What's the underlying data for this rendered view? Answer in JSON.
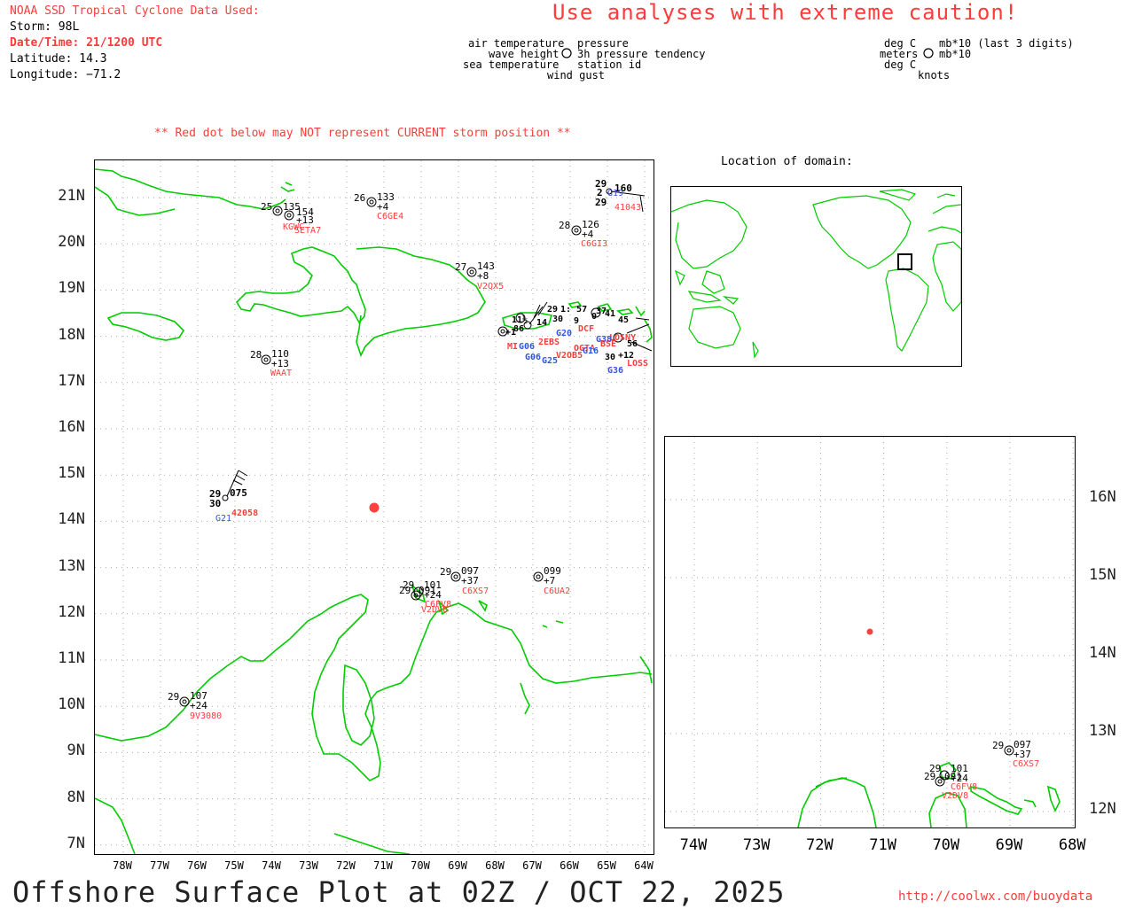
{
  "header": {
    "data_title": "NOAA SSD Tropical Cyclone Data Used:",
    "storm": "Storm: 98L",
    "datetime": "Date/Time: 21/1200 UTC",
    "latitude": "Latitude: 14.3",
    "longitude": "Longitude: −71.2",
    "caution": "Use analyses with extreme caution!",
    "note": "** Red dot below may NOT represent CURRENT storm position **"
  },
  "legend_left": {
    "air_temperature": "air temperature",
    "pressure": "pressure",
    "wave_height": "wave height",
    "pressure_tendency": "3h pressure tendency",
    "sea_temperature": "sea temperature",
    "station_id": "station id",
    "wind_gust": "wind gust"
  },
  "legend_right": {
    "deg_c_1": "deg C",
    "mb_last3": "mb*10 (last 3 digits)",
    "meters": "meters",
    "mb10": "mb*10",
    "deg_c_2": "deg C",
    "knots": "knots"
  },
  "location_title": "Location of domain:",
  "main_map": {
    "lat_labels": [
      "21N",
      "20N",
      "19N",
      "18N",
      "17N",
      "16N",
      "15N",
      "14N",
      "13N",
      "12N",
      "11N",
      "10N",
      "9N",
      "8N",
      "7N"
    ],
    "lon_labels": [
      "78W",
      "77W",
      "76W",
      "75W",
      "74W",
      "73W",
      "72W",
      "71W",
      "70W",
      "69W",
      "68W",
      "67W",
      "66W",
      "65W",
      "64W"
    ]
  },
  "zoom_map": {
    "lat_labels": [
      "16N",
      "15N",
      "14N",
      "13N",
      "12N"
    ],
    "lon_labels": [
      "74W",
      "73W",
      "72W",
      "71W",
      "70W",
      "69W",
      "68W"
    ]
  },
  "stations": [
    {
      "id": "KGWC",
      "temp": "25",
      "pres": "135",
      "tend": ""
    },
    {
      "id": "SETA7",
      "temp": "",
      "pres": "154",
      "tend": "+13"
    },
    {
      "id": "C6GE4",
      "temp": "26",
      "pres": "133",
      "tend": "+4"
    },
    {
      "id": "41043",
      "temp": "29",
      "pres": "160",
      "tend": "",
      "sea": "29",
      "wave": "2",
      "extra": "G19"
    },
    {
      "id": "C6GI3",
      "temp": "28",
      "pres": "126",
      "tend": "+4"
    },
    {
      "id": "V2QX5",
      "temp": "27",
      "pres": "143",
      "tend": "+8"
    },
    {
      "id": "WAAT",
      "temp": "28",
      "pres": "110",
      "tend": "+13"
    },
    {
      "id": "42058",
      "temp": "29",
      "pres": "075",
      "tend": "",
      "sea": "30",
      "extra": "G21"
    },
    {
      "id": "C6XS7",
      "temp": "29",
      "pres": "097",
      "tend": "+37"
    },
    {
      "id": "C6UA2",
      "temp": "",
      "pres": "099",
      "tend": "+7"
    },
    {
      "id": "C6FV8",
      "temp": "29",
      "pres": "101",
      "tend": "+24"
    },
    {
      "id": "V2DV8",
      "temp": "29",
      "pres": "091",
      "tend": ""
    },
    {
      "id": "9V3080",
      "temp": "29",
      "pres": "107",
      "tend": "+24"
    }
  ],
  "storm_dot_color": "#ff4040",
  "land_color": "#00cc00",
  "footer": {
    "title": "Offshore Surface Plot at 02Z / OCT 22, 2025",
    "url": "http://coolwx.com/buoydata"
  }
}
